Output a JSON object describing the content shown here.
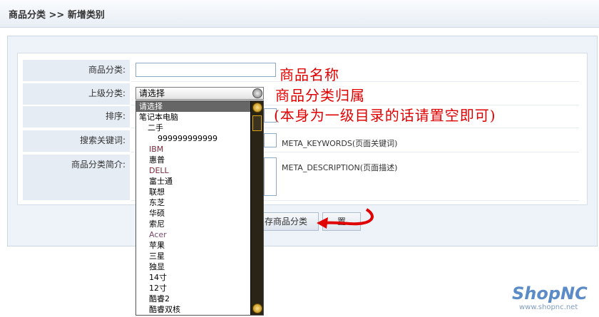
{
  "breadcrumb": "商品分类 >> 新增类别",
  "form": {
    "category_label": "商品分类:",
    "parent_label": "上级分类:",
    "sort_label": "排序:",
    "keywords_label": "搜索关键词:",
    "description_label": "商品分类简介:",
    "parent_selected": "请选择",
    "keywords_hint": "META_KEYWORDS(页面关键词)",
    "description_hint": "META_DESCRIPTION(页面描述)"
  },
  "annotations": {
    "line1": "商品名称",
    "line2": "商品分类归属",
    "line3": "(本身为一级目录的话请置空即可)"
  },
  "buttons": {
    "save": "存商品分类",
    "reset": "置"
  },
  "dropdown_options": [
    {
      "label": "请选择",
      "level": "sel"
    },
    {
      "label": "笔记本电脑",
      "level": "l0"
    },
    {
      "label": "二手",
      "level": "l1"
    },
    {
      "label": "999999999999",
      "level": "l2"
    },
    {
      "label": "IBM",
      "level": "l1b",
      "color": "#7a2a3a"
    },
    {
      "label": "惠普",
      "level": "l1b"
    },
    {
      "label": "DELL",
      "level": "l1b",
      "color": "#7a2a3a"
    },
    {
      "label": "富士通",
      "level": "l1b"
    },
    {
      "label": "联想",
      "level": "l1b"
    },
    {
      "label": "东芝",
      "level": "l1b"
    },
    {
      "label": "华硕",
      "level": "l1b"
    },
    {
      "label": "索尼",
      "level": "l1b"
    },
    {
      "label": "Acer",
      "level": "l1b",
      "color": "#7a4a6a"
    },
    {
      "label": "苹果",
      "level": "l1b"
    },
    {
      "label": "三星",
      "level": "l1b"
    },
    {
      "label": "独显",
      "level": "l1b"
    },
    {
      "label": "14寸",
      "level": "l1b"
    },
    {
      "label": "12寸",
      "level": "l1b"
    },
    {
      "label": "酷睿2",
      "level": "l1b"
    },
    {
      "label": "酷睿双核",
      "level": "l1b"
    }
  ],
  "logo": {
    "name": "ShopNC",
    "url": "www.shopnc.net"
  },
  "colors": {
    "annotation": "#e00000",
    "accent_arrow": "#e00000"
  }
}
